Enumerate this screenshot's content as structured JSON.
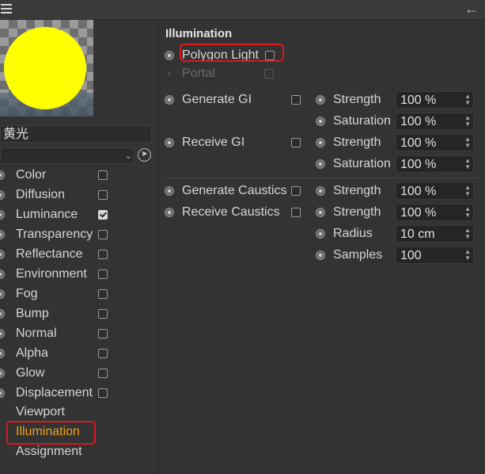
{
  "window": {
    "menu_icon": "hamburger-icon",
    "back_icon": "arrow-left-icon",
    "back_glyph": "←"
  },
  "material": {
    "name": "黄光",
    "preview_color": "#ffff00"
  },
  "channels": [
    {
      "label": "Color",
      "checked": false
    },
    {
      "label": "Diffusion",
      "checked": false
    },
    {
      "label": "Luminance",
      "checked": true
    },
    {
      "label": "Transparency",
      "checked": false
    },
    {
      "label": "Reflectance",
      "checked": false
    },
    {
      "label": "Environment",
      "checked": false
    },
    {
      "label": "Fog",
      "checked": false
    },
    {
      "label": "Bump",
      "checked": false
    },
    {
      "label": "Normal",
      "checked": false
    },
    {
      "label": "Alpha",
      "checked": false
    },
    {
      "label": "Glow",
      "checked": false
    },
    {
      "label": "Displacement",
      "checked": false
    }
  ],
  "side_links": {
    "viewport": "Viewport",
    "illumination": "Illumination",
    "assignment": "Assignment"
  },
  "illumination": {
    "title": "Illumination",
    "polygon_light": {
      "label": "Polygon Light",
      "checked": true
    },
    "portal": {
      "label": "Portal",
      "checked": false,
      "enabled": false
    },
    "generate_gi": {
      "label": "Generate GI",
      "checked": true,
      "strength_label": "Strength",
      "strength": "100 %",
      "saturation_label": "Saturation",
      "saturation": "100 %"
    },
    "receive_gi": {
      "label": "Receive GI",
      "checked": true,
      "strength_label": "Strength",
      "strength": "100 %",
      "saturation_label": "Saturation",
      "saturation": "100 %"
    },
    "generate_caustics": {
      "label": "Generate Caustics",
      "checked": true,
      "strength_label": "Strength",
      "strength": "100 %"
    },
    "receive_caustics": {
      "label": "Receive Caustics",
      "checked": true,
      "strength_label": "Strength",
      "strength": "100 %",
      "radius_label": "Radius",
      "radius": "10 cm",
      "samples_label": "Samples",
      "samples": "100"
    }
  },
  "colors": {
    "background": "#333333",
    "active_link": "#f19e17",
    "annotation_box": "#e0161d"
  }
}
